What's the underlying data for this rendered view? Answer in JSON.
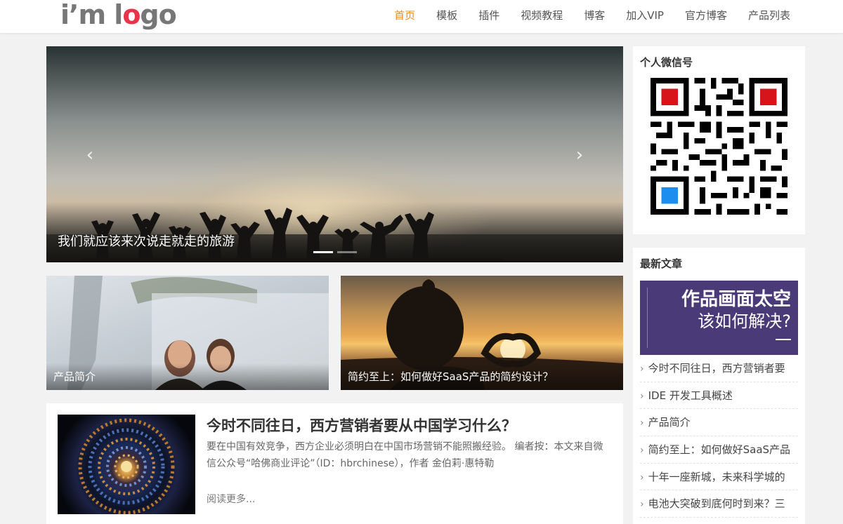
{
  "header": {
    "logo": {
      "part1": "i’m l",
      "part2": "o",
      "part3": "go"
    },
    "nav": [
      {
        "label": "首页",
        "active": true
      },
      {
        "label": "模板"
      },
      {
        "label": "插件"
      },
      {
        "label": "视频教程"
      },
      {
        "label": "博客"
      },
      {
        "label": "加入VIP"
      },
      {
        "label": "官方博客"
      },
      {
        "label": "产品列表"
      }
    ]
  },
  "hero": {
    "caption": "我们就应该来次说走就走的旅游",
    "prev_icon": "chevron-left-icon",
    "next_icon": "chevron-right-icon",
    "slides": 2,
    "active_slide": 1
  },
  "cards": [
    {
      "caption": "产品简介"
    },
    {
      "caption": "简约至上：如何做好SaaS产品的简约设计？"
    }
  ],
  "article": {
    "title": "今时不同往日，西方营销者要从中国学习什么？",
    "excerpt": "要在中国有效竞争，西方企业必须明白在中国市场营销不能照搬经验。 编者按：本文来自微信公众号“哈佛商业评论”（ID：hbrchinese），作者 金伯莉·惠特勒",
    "more": "阅读更多..."
  },
  "sidebar": {
    "wechat_title": "个人微信号",
    "posts_title": "最新文章",
    "banner": {
      "line1": "作品画面太空",
      "line2": "该如何解决?"
    },
    "posts": [
      "今时不同往日，西方营销者要",
      "IDE 开发工具概述",
      "产品简介",
      "简约至上：如何做好SaaS产品",
      "十年一座新城，未来科学城的",
      "电池大突破到底何时到来？三"
    ]
  },
  "colors": {
    "accent": "#f0891a",
    "logo_red": "#e8344a",
    "banner_bg": "#4a3a78"
  }
}
